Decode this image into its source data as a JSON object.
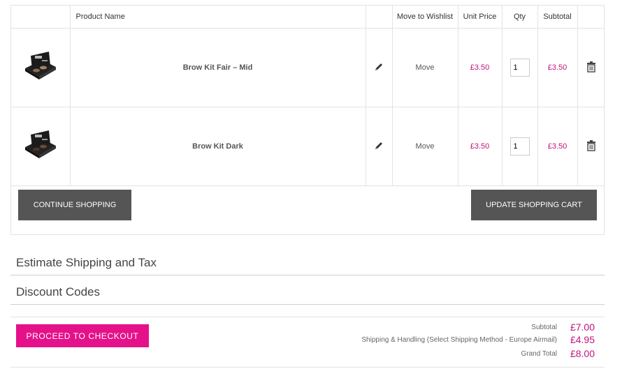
{
  "table": {
    "headers": {
      "image": "",
      "name": "Product Name",
      "edit": "",
      "wishlist": "Move to Wishlist",
      "unit_price": "Unit Price",
      "qty": "Qty",
      "subtotal": "Subtotal",
      "remove": ""
    },
    "rows": [
      {
        "name": "Brow Kit Fair – Mid",
        "wishlist": "Move",
        "unit_price": "£3.50",
        "qty": "1",
        "subtotal": "£3.50",
        "thumb_icon": "brow-kit-image"
      },
      {
        "name": "Brow Kit Dark",
        "wishlist": "Move",
        "unit_price": "£3.50",
        "qty": "1",
        "subtotal": "£3.50",
        "thumb_icon": "brow-kit-image"
      }
    ],
    "edit_icon": "pencil-icon",
    "remove_icon": "trash-icon"
  },
  "actions": {
    "continue": "CONTINUE SHOPPING",
    "update": "UPDATE SHOPPING CART"
  },
  "sections": {
    "shipping": "Estimate Shipping and Tax",
    "discount": "Discount Codes"
  },
  "checkout": {
    "button": "PROCEED TO CHECKOUT"
  },
  "totals": {
    "subtotal_label": "Subtotal",
    "subtotal_value": "£7.00",
    "shipping_label": "Shipping & Handling (Select Shipping Method - Europe Airmail)",
    "shipping_value": "£4.95",
    "grand_label": "Grand Total",
    "grand_value": "£8.00"
  },
  "colors": {
    "accent": "#e5118a",
    "price": "#c0137a",
    "dark_button": "#555555"
  }
}
